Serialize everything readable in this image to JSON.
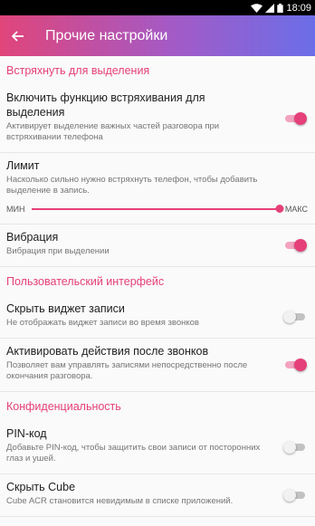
{
  "status_bar": {
    "time": "18:09"
  },
  "toolbar": {
    "title": "Прочие настройки"
  },
  "sections": {
    "shake": {
      "header": "Встряхнуть для выделения",
      "enable": {
        "title": "Включить функцию встряхивания для выделения",
        "summary": "Активирует выделение важных частей разговора при встряхивании телефона",
        "enabled": true
      },
      "limit": {
        "title": "Лимит",
        "summary": "Насколько сильно нужно встряхнуть телефон, чтобы добавить выделение в запись.",
        "min_label": "МИН",
        "max_label": "МАКС",
        "value_fraction": 1.0
      },
      "vibration": {
        "title": "Вибрация",
        "summary": "Вибрация при выделении",
        "enabled": true
      }
    },
    "ui": {
      "header": "Пользовательский интерфейс",
      "hide_widget": {
        "title": "Скрыть виджет записи",
        "summary": "Не отображать виджет записи во время звонков",
        "enabled": false
      },
      "after_call": {
        "title": "Активировать действия после звонков",
        "summary": "Позволяет вам управлять записями непосредственно после окончания разговора.",
        "enabled": true
      }
    },
    "privacy": {
      "header": "Конфиденциальность",
      "pin": {
        "title": "PIN-код",
        "summary": "Добавьте PIN-код, чтобы защитить свои записи от посторонних глаз и ушей.",
        "enabled": false
      },
      "hide_cube": {
        "title": "Скрыть Cube",
        "summary": "Cube ACR становится невидимым в списке приложений.",
        "enabled": false
      }
    }
  },
  "colors": {
    "accent": "#e5407a",
    "toolbar_start": "#e0457a",
    "toolbar_end": "#6b6ee8"
  }
}
